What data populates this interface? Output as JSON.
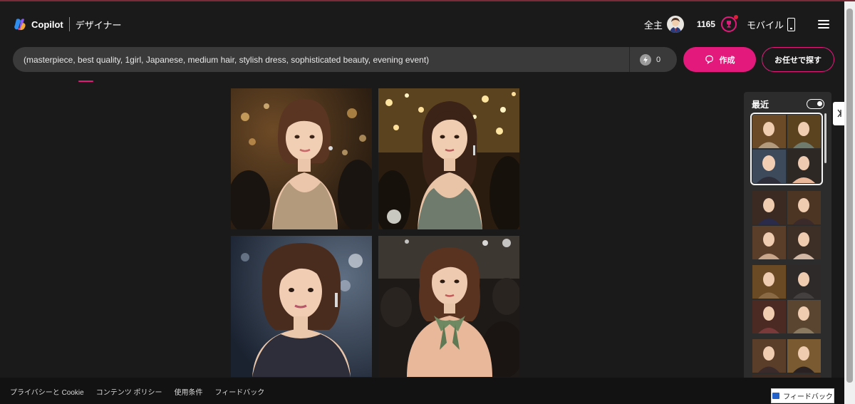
{
  "header": {
    "brand": "Copilot",
    "product": "デザイナー",
    "user_name": "全主",
    "coin_count": "1165",
    "mobile_label": "モバイル"
  },
  "prompt": {
    "value": "(masterpiece, best quality, 1girl, Japanese, medium hair, stylish dress, sophisticated beauty, evening event)",
    "boost_count": "0"
  },
  "actions": {
    "create_label": "作成",
    "surprise_label": "お任せで探す"
  },
  "recent": {
    "title": "最近"
  },
  "footer": {
    "links": [
      "プライバシーと Cookie",
      "コンテンツ ポリシー",
      "使用条件",
      "フィードバック"
    ],
    "feedback_button": "フィードバック"
  },
  "colors": {
    "accent": "#e4197c",
    "background": "#1b1a1a",
    "prompt_bg": "#3b3a3a",
    "panel_bg": "#2d2c2c",
    "footer_bg": "#121212"
  },
  "icons": [
    "copilot-logo-icon",
    "avatar",
    "reward-icon",
    "phone-icon",
    "menu-icon",
    "boost-icon",
    "create-icon",
    "feedback-icon"
  ]
}
